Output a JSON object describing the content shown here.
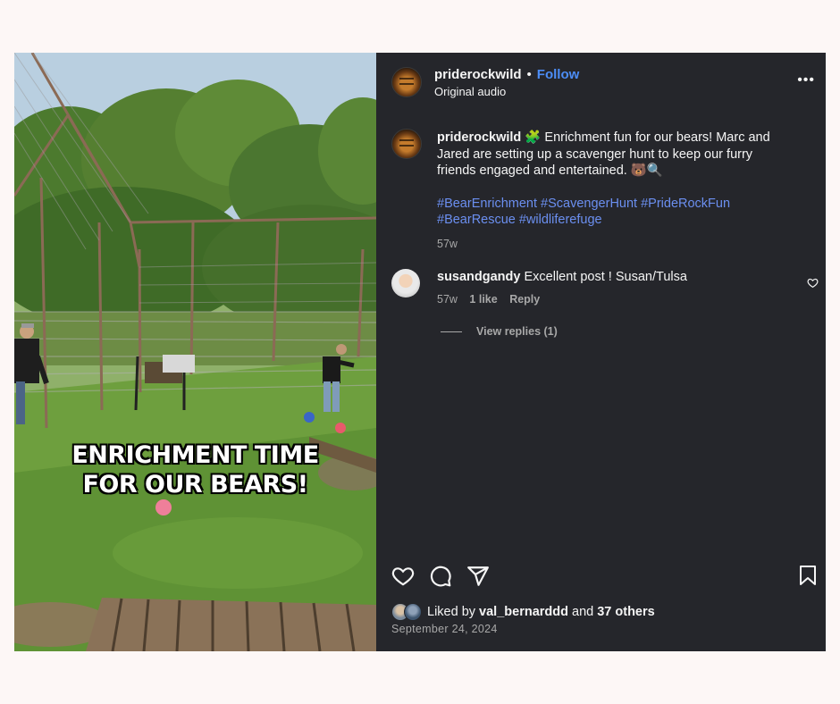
{
  "media": {
    "overlay_line1": "ENRICHMENT TIME",
    "overlay_line2": "FOR OUR BEARS!"
  },
  "header": {
    "username": "priderockwild",
    "dot": "•",
    "follow_label": "Follow",
    "audio_label": "Original audio",
    "more_label": "•••"
  },
  "caption": {
    "username": "priderockwild",
    "emoji_prefix": "🧩",
    "text": "Enrichment fun for our bears! Marc and Jared are setting up a scavenger hunt to keep our furry friends engaged and entertained. 🐻🔍",
    "hashtags": "#BearEnrichment #ScavengerHunt #PrideRockFun #BearRescue #wildliferefuge",
    "time": "57w"
  },
  "comment": {
    "username": "susandgandy",
    "text": "Excellent post ! Susan/Tulsa",
    "time": "57w",
    "likes": "1 like",
    "reply_label": "Reply",
    "view_replies": "View replies (1)"
  },
  "likes": {
    "prefix": "Liked by",
    "user": "val_bernarddd",
    "and": "and",
    "others": "37 others"
  },
  "date": "September 24, 2024",
  "icons": {
    "like": "heart-icon",
    "comment": "comment-icon",
    "share": "share-icon",
    "save": "bookmark-icon"
  },
  "colors": {
    "panel_bg": "#25262b",
    "link_blue": "#4c8df6",
    "hashtag_blue": "#6b8ff0",
    "page_bg": "#fdf7f6"
  }
}
